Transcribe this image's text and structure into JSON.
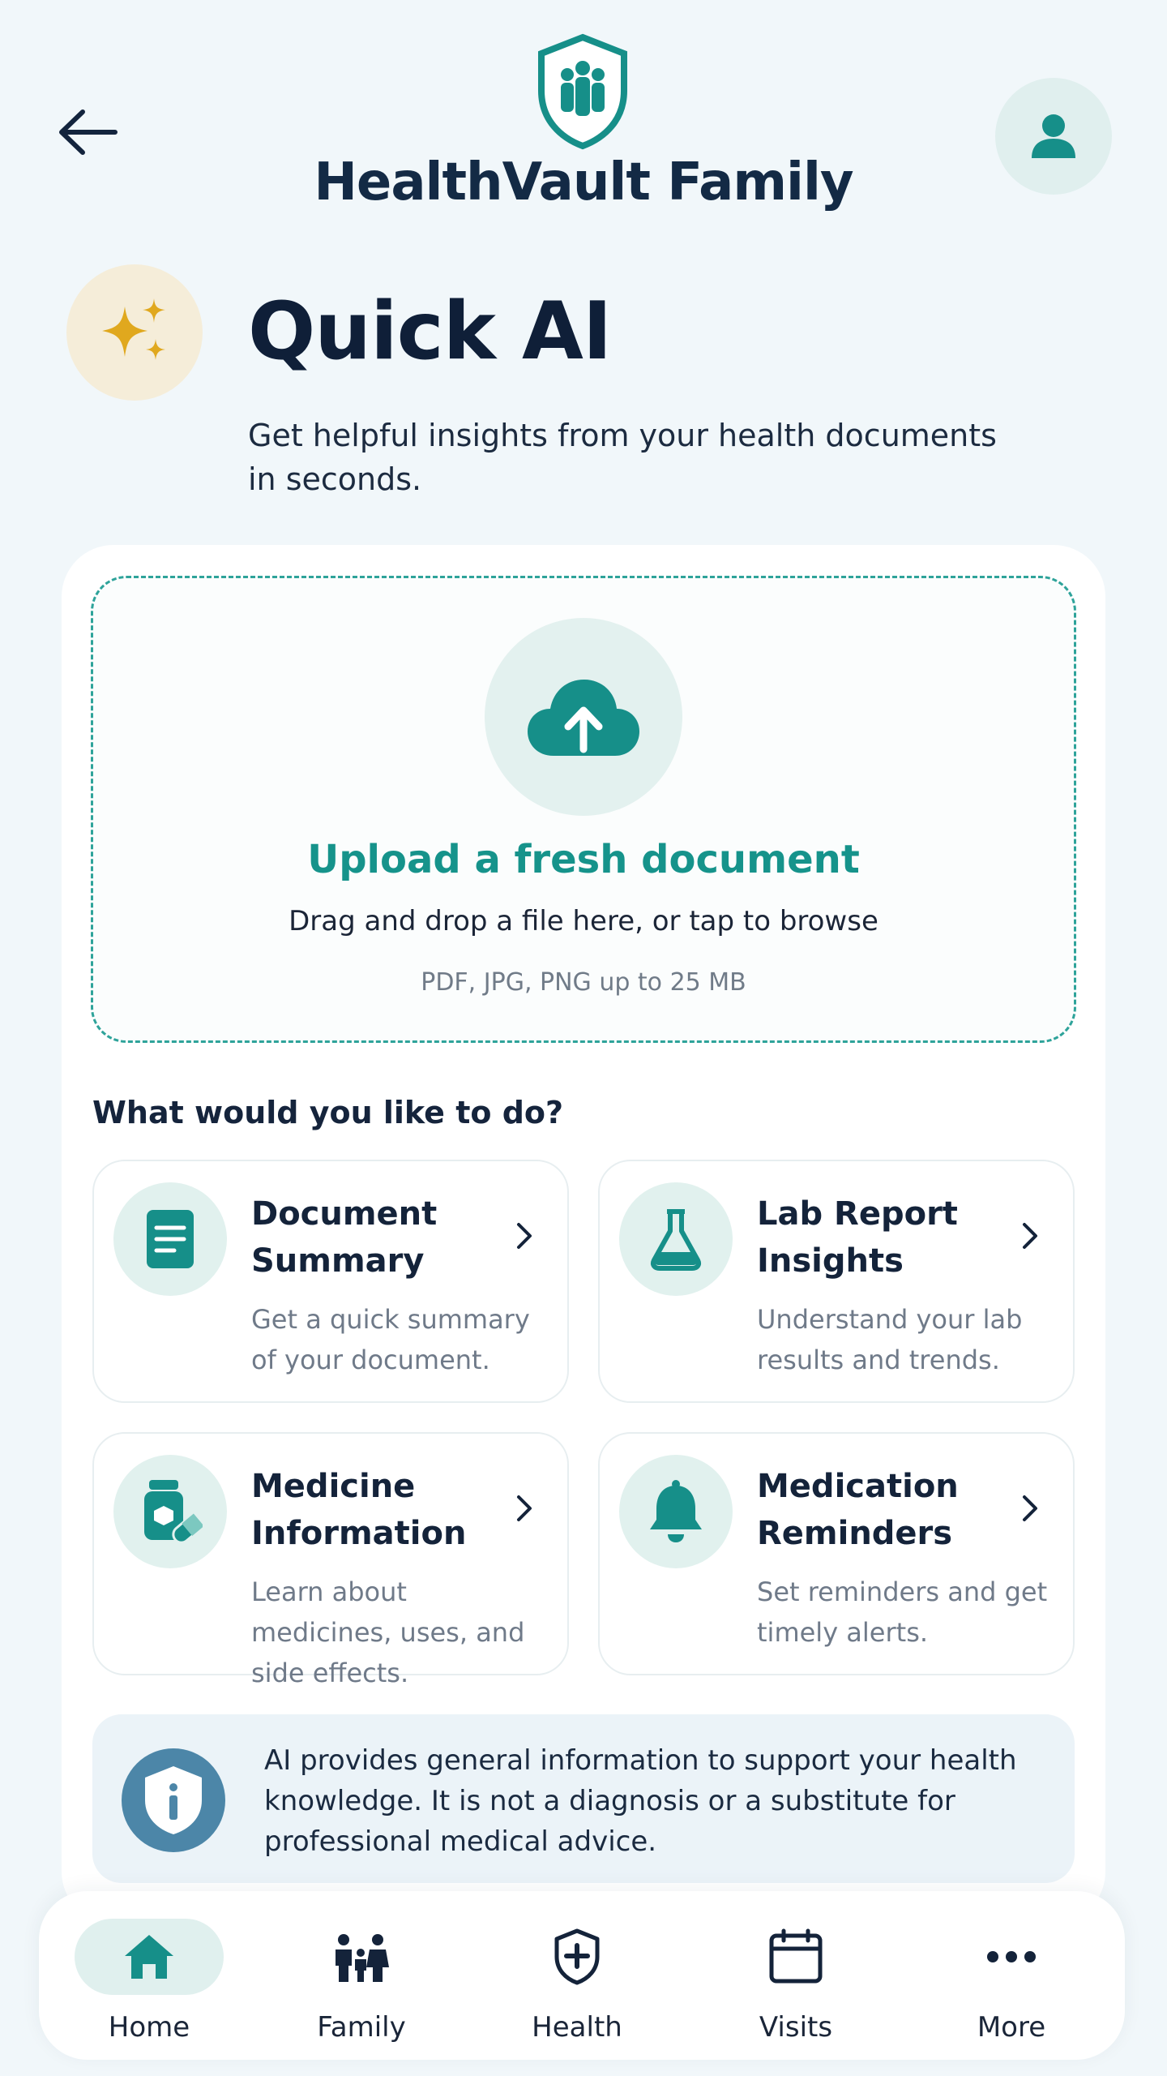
{
  "header": {
    "brand": "HealthVault Family",
    "back_icon": "arrow-left-icon",
    "logo_icon": "family-shield-icon",
    "profile_icon": "user-icon"
  },
  "hero": {
    "title": "Quick AI",
    "subtitle": "Get helpful insights from your health documents in seconds.",
    "icon": "sparkles-icon"
  },
  "upload": {
    "icon": "cloud-upload-icon",
    "title": "Upload a fresh document",
    "description": "Drag and drop a file here, or tap to browse",
    "hint": "PDF, JPG, PNG up to 25 MB"
  },
  "actions": {
    "heading": "What would you like to do?",
    "items": [
      {
        "icon": "document-icon",
        "title": "Document Summary",
        "description": "Get a quick summary of your document."
      },
      {
        "icon": "flask-icon",
        "title": "Lab Report Insights",
        "description": "Understand your lab results and trends."
      },
      {
        "icon": "pill-bottle-icon",
        "title": "Medicine Information",
        "description": "Learn about medicines, uses, and side effects."
      },
      {
        "icon": "bell-icon",
        "title": "Medication Reminders",
        "description": "Set reminders and get timely alerts."
      }
    ]
  },
  "disclaimer": {
    "icon": "info-shield-icon",
    "text": "AI provides general information to support your health knowledge. It is not a diagnosis or a substitute for professional medical advice."
  },
  "nav": {
    "items": [
      {
        "label": "Home",
        "icon": "home-icon",
        "active": true
      },
      {
        "label": "Family",
        "icon": "family-icon",
        "active": false
      },
      {
        "label": "Health",
        "icon": "health-shield-icon",
        "active": false
      },
      {
        "label": "Visits",
        "icon": "calendar-icon",
        "active": false
      },
      {
        "label": "More",
        "icon": "more-icon",
        "active": false
      }
    ]
  },
  "colors": {
    "accent": "#16938b",
    "background": "#f1f7fa",
    "gold": "#e0a81e",
    "info": "#4c86a8"
  }
}
